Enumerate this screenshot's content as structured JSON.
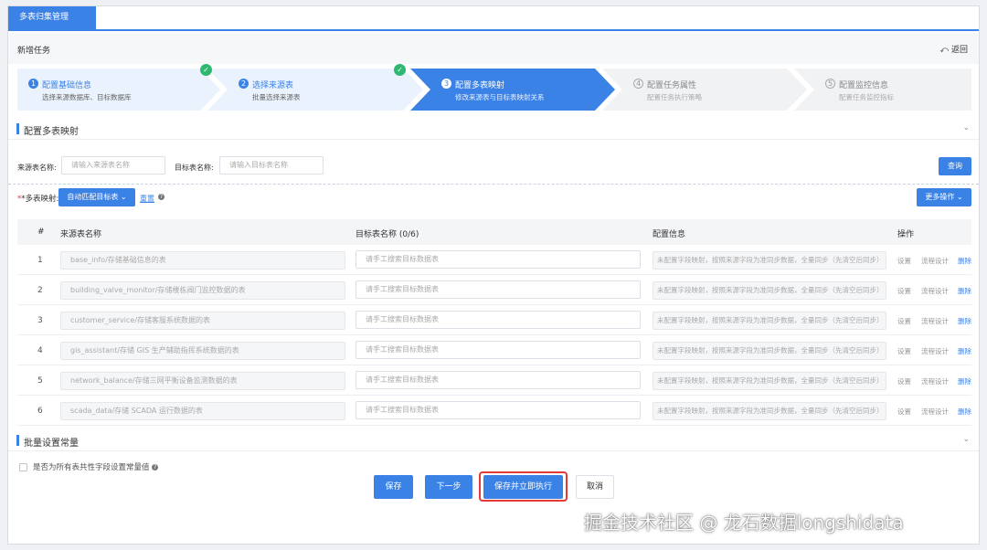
{
  "tab": {
    "label": "多表归集管理"
  },
  "header": {
    "title": "新增任务",
    "back_label": "返回"
  },
  "steps": [
    {
      "num": "1",
      "title": "配置基础信息",
      "sub": "选择来源数据库、目标数据库",
      "state": "done"
    },
    {
      "num": "2",
      "title": "选择来源表",
      "sub": "批量选择来源表",
      "state": "done"
    },
    {
      "num": "3",
      "title": "配置多表映射",
      "sub": "修改来源表与目标表映射关系",
      "state": "active"
    },
    {
      "num": "4",
      "title": "配置任务属性",
      "sub": "配置任务执行策略",
      "state": "todo"
    },
    {
      "num": "5",
      "title": "配置监控信息",
      "sub": "配置任务监控指标",
      "state": "todo"
    }
  ],
  "section_mapping": {
    "title": "配置多表映射"
  },
  "filters": {
    "source_label": "来源表名称:",
    "source_placeholder": "请输入来源表名称",
    "target_label": "目标表名称:",
    "target_placeholder": "请输入目标表名称",
    "query_label": "查询"
  },
  "mapping_bar": {
    "label": "*多表映射:",
    "auto_match_label": "自动匹配目标表",
    "reset_label": "重置",
    "more_label": "更多操作"
  },
  "table": {
    "headers": {
      "idx": "#",
      "source": "来源表名称",
      "target": "目标表名称 (0/6)",
      "config": "配置信息",
      "ops": "操作"
    },
    "rows": [
      {
        "idx": "1",
        "source": "base_info/存储基础信息的表",
        "target_placeholder": "请手工搜索目标数据表",
        "config": "未配置字段映射，按照来源字段为准同步数据，全量同步（先清空后同步）",
        "op_set": "设置",
        "op_flow": "流程设计",
        "op_del": "删除"
      },
      {
        "idx": "2",
        "source": "building_valve_monitor/存储楼栋阀门监控数据的表",
        "target_placeholder": "请手工搜索目标数据表",
        "config": "未配置字段映射，按照来源字段为准同步数据，全量同步（先清空后同步）",
        "op_set": "设置",
        "op_flow": "流程设计",
        "op_del": "删除"
      },
      {
        "idx": "3",
        "source": "customer_service/存储客服系统数据的表",
        "target_placeholder": "请手工搜索目标数据表",
        "config": "未配置字段映射，按照来源字段为准同步数据，全量同步（先清空后同步）",
        "op_set": "设置",
        "op_flow": "流程设计",
        "op_del": "删除"
      },
      {
        "idx": "4",
        "source": "gis_assistant/存储 GIS 生产辅助指挥系统数据的表",
        "target_placeholder": "请手工搜索目标数据表",
        "config": "未配置字段映射，按照来源字段为准同步数据，全量同步（先清空后同步）",
        "op_set": "设置",
        "op_flow": "流程设计",
        "op_del": "删除"
      },
      {
        "idx": "5",
        "source": "network_balance/存储三网平衡设备监测数据的表",
        "target_placeholder": "请手工搜索目标数据表",
        "config": "未配置字段映射，按照来源字段为准同步数据，全量同步（先清空后同步）",
        "op_set": "设置",
        "op_flow": "流程设计",
        "op_del": "删除"
      },
      {
        "idx": "6",
        "source": "scada_data/存储 SCADA 运行数据的表",
        "target_placeholder": "请手工搜索目标数据表",
        "config": "未配置字段映射，按照来源字段为准同步数据，全量同步（先清空后同步）",
        "op_set": "设置",
        "op_flow": "流程设计",
        "op_del": "删除"
      }
    ]
  },
  "section_constants": {
    "title": "批量设置常量"
  },
  "constants": {
    "checkbox_label": "是否为所有表共性字段设置常量值"
  },
  "footer": {
    "save_label": "保存",
    "next_label": "下一步",
    "save_run_label": "保存并立即执行",
    "cancel_label": "取消"
  },
  "watermark": {
    "text": "掘金技术社区 @ 龙石数据longshidata"
  },
  "colors": {
    "accent": "#3b82e6",
    "success": "#2eb872",
    "highlight": "#e53935"
  }
}
